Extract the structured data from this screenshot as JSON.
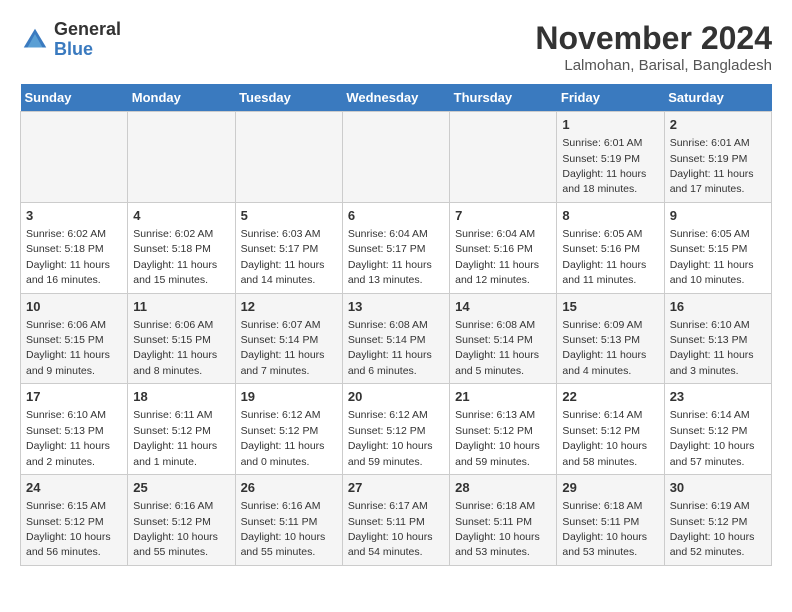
{
  "logo": {
    "general": "General",
    "blue": "Blue"
  },
  "header": {
    "month": "November 2024",
    "location": "Lalmohan, Barisal, Bangladesh"
  },
  "weekdays": [
    "Sunday",
    "Monday",
    "Tuesday",
    "Wednesday",
    "Thursday",
    "Friday",
    "Saturday"
  ],
  "weeks": [
    [
      {
        "day": "",
        "info": ""
      },
      {
        "day": "",
        "info": ""
      },
      {
        "day": "",
        "info": ""
      },
      {
        "day": "",
        "info": ""
      },
      {
        "day": "",
        "info": ""
      },
      {
        "day": "1",
        "info": "Sunrise: 6:01 AM\nSunset: 5:19 PM\nDaylight: 11 hours\nand 18 minutes."
      },
      {
        "day": "2",
        "info": "Sunrise: 6:01 AM\nSunset: 5:19 PM\nDaylight: 11 hours\nand 17 minutes."
      }
    ],
    [
      {
        "day": "3",
        "info": "Sunrise: 6:02 AM\nSunset: 5:18 PM\nDaylight: 11 hours\nand 16 minutes."
      },
      {
        "day": "4",
        "info": "Sunrise: 6:02 AM\nSunset: 5:18 PM\nDaylight: 11 hours\nand 15 minutes."
      },
      {
        "day": "5",
        "info": "Sunrise: 6:03 AM\nSunset: 5:17 PM\nDaylight: 11 hours\nand 14 minutes."
      },
      {
        "day": "6",
        "info": "Sunrise: 6:04 AM\nSunset: 5:17 PM\nDaylight: 11 hours\nand 13 minutes."
      },
      {
        "day": "7",
        "info": "Sunrise: 6:04 AM\nSunset: 5:16 PM\nDaylight: 11 hours\nand 12 minutes."
      },
      {
        "day": "8",
        "info": "Sunrise: 6:05 AM\nSunset: 5:16 PM\nDaylight: 11 hours\nand 11 minutes."
      },
      {
        "day": "9",
        "info": "Sunrise: 6:05 AM\nSunset: 5:15 PM\nDaylight: 11 hours\nand 10 minutes."
      }
    ],
    [
      {
        "day": "10",
        "info": "Sunrise: 6:06 AM\nSunset: 5:15 PM\nDaylight: 11 hours\nand 9 minutes."
      },
      {
        "day": "11",
        "info": "Sunrise: 6:06 AM\nSunset: 5:15 PM\nDaylight: 11 hours\nand 8 minutes."
      },
      {
        "day": "12",
        "info": "Sunrise: 6:07 AM\nSunset: 5:14 PM\nDaylight: 11 hours\nand 7 minutes."
      },
      {
        "day": "13",
        "info": "Sunrise: 6:08 AM\nSunset: 5:14 PM\nDaylight: 11 hours\nand 6 minutes."
      },
      {
        "day": "14",
        "info": "Sunrise: 6:08 AM\nSunset: 5:14 PM\nDaylight: 11 hours\nand 5 minutes."
      },
      {
        "day": "15",
        "info": "Sunrise: 6:09 AM\nSunset: 5:13 PM\nDaylight: 11 hours\nand 4 minutes."
      },
      {
        "day": "16",
        "info": "Sunrise: 6:10 AM\nSunset: 5:13 PM\nDaylight: 11 hours\nand 3 minutes."
      }
    ],
    [
      {
        "day": "17",
        "info": "Sunrise: 6:10 AM\nSunset: 5:13 PM\nDaylight: 11 hours\nand 2 minutes."
      },
      {
        "day": "18",
        "info": "Sunrise: 6:11 AM\nSunset: 5:12 PM\nDaylight: 11 hours\nand 1 minute."
      },
      {
        "day": "19",
        "info": "Sunrise: 6:12 AM\nSunset: 5:12 PM\nDaylight: 11 hours\nand 0 minutes."
      },
      {
        "day": "20",
        "info": "Sunrise: 6:12 AM\nSunset: 5:12 PM\nDaylight: 10 hours\nand 59 minutes."
      },
      {
        "day": "21",
        "info": "Sunrise: 6:13 AM\nSunset: 5:12 PM\nDaylight: 10 hours\nand 59 minutes."
      },
      {
        "day": "22",
        "info": "Sunrise: 6:14 AM\nSunset: 5:12 PM\nDaylight: 10 hours\nand 58 minutes."
      },
      {
        "day": "23",
        "info": "Sunrise: 6:14 AM\nSunset: 5:12 PM\nDaylight: 10 hours\nand 57 minutes."
      }
    ],
    [
      {
        "day": "24",
        "info": "Sunrise: 6:15 AM\nSunset: 5:12 PM\nDaylight: 10 hours\nand 56 minutes."
      },
      {
        "day": "25",
        "info": "Sunrise: 6:16 AM\nSunset: 5:12 PM\nDaylight: 10 hours\nand 55 minutes."
      },
      {
        "day": "26",
        "info": "Sunrise: 6:16 AM\nSunset: 5:11 PM\nDaylight: 10 hours\nand 55 minutes."
      },
      {
        "day": "27",
        "info": "Sunrise: 6:17 AM\nSunset: 5:11 PM\nDaylight: 10 hours\nand 54 minutes."
      },
      {
        "day": "28",
        "info": "Sunrise: 6:18 AM\nSunset: 5:11 PM\nDaylight: 10 hours\nand 53 minutes."
      },
      {
        "day": "29",
        "info": "Sunrise: 6:18 AM\nSunset: 5:11 PM\nDaylight: 10 hours\nand 53 minutes."
      },
      {
        "day": "30",
        "info": "Sunrise: 6:19 AM\nSunset: 5:12 PM\nDaylight: 10 hours\nand 52 minutes."
      }
    ]
  ]
}
